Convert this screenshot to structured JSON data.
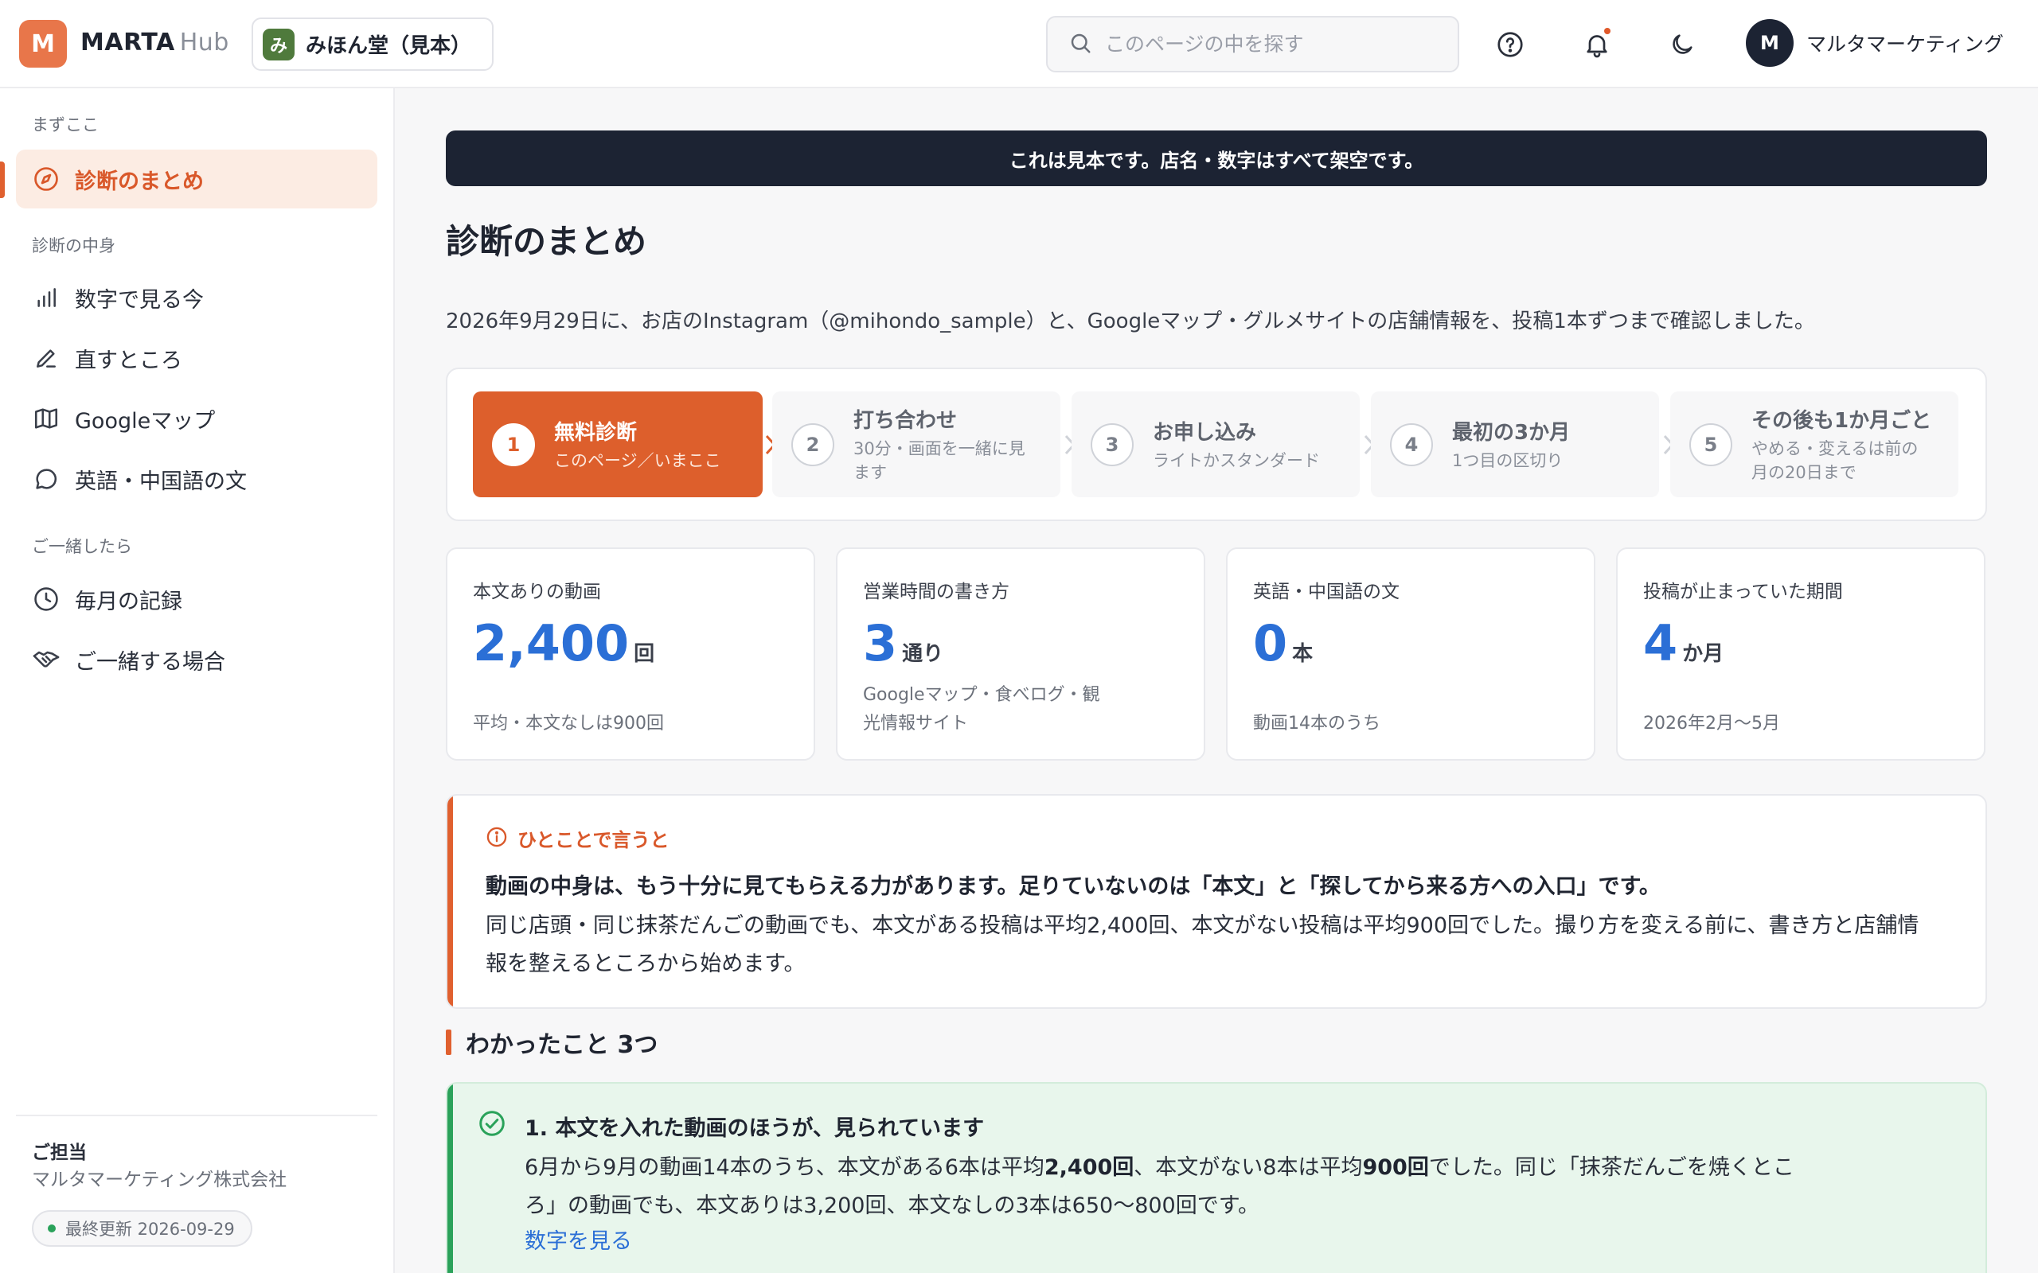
{
  "header": {
    "logo_letter": "M",
    "brand": "MARTA",
    "brand_suffix": "Hub",
    "store_avatar": "み",
    "store_name": "みほん堂（見本）",
    "search_placeholder": "このページの中を探す",
    "user_initial": "M",
    "user_name": "マルタマーケティング",
    "icons": [
      "search-icon",
      "help-icon",
      "bell-icon",
      "moon-icon"
    ],
    "notification_dot_color": "#e0592a"
  },
  "sidebar": {
    "section_start": "まずここ",
    "section_content": "診断の中身",
    "section_together": "ご一緒したら",
    "items": [
      {
        "label": "診断のまとめ",
        "icon": "compass-icon",
        "active": true
      },
      {
        "label": "数字で見る今",
        "icon": "bar-chart-icon"
      },
      {
        "label": "直すところ",
        "icon": "pencil-icon"
      },
      {
        "label": "Googleマップ",
        "icon": "map-icon"
      },
      {
        "label": "英語・中国語の文",
        "icon": "chat-icon"
      },
      {
        "label": "毎月の記録",
        "icon": "clock-icon"
      },
      {
        "label": "ご一緒する場合",
        "icon": "handshake-icon"
      }
    ],
    "owner_label": "ご担当",
    "owner_name": "マルタマーケティング株式会社",
    "updated": "最終更新 2026-09-29"
  },
  "main": {
    "notice": "これは見本です。店名・数字はすべて架空です。",
    "title": "診断のまとめ",
    "intro": "2026年9月29日に、お店のInstagram（@mihondo_sample）と、Googleマップ・グルメサイトの店舗情報を、投稿1本ずつまで確認しました。",
    "steps": [
      {
        "num": "1",
        "title": "無料診断",
        "sub": "このページ／いまここ",
        "active": true
      },
      {
        "num": "2",
        "title": "打ち合わせ",
        "sub": "30分・画面を一緒に見ます"
      },
      {
        "num": "3",
        "title": "お申し込み",
        "sub": "ライトかスタンダード"
      },
      {
        "num": "4",
        "title": "最初の3か月",
        "sub": "1つ目の区切り"
      },
      {
        "num": "5",
        "title": "その後も1か月ごと",
        "sub": "やめる・変えるは前の月の20日まで"
      }
    ],
    "stats": [
      {
        "label": "本文ありの動画",
        "value": "2,400",
        "unit": "回",
        "sub": "平均・本文なしは900回"
      },
      {
        "label": "営業時間の書き方",
        "value": "3",
        "unit": "通り",
        "sub": "Googleマップ・食べログ・観光情報サイト"
      },
      {
        "label": "英語・中国語の文",
        "value": "0",
        "unit": "本",
        "sub": "動画14本のうち"
      },
      {
        "label": "投稿が止まっていた期間",
        "value": "4",
        "unit": "か月",
        "sub": "2026年2月〜5月"
      }
    ],
    "summary": {
      "heading": "ひとことで言うと",
      "lead": "動画の中身は、もう十分に見てもらえる力があります。足りていないのは「本文」と「探してから来る方への入口」です。",
      "body": "同じ店頭・同じ抹茶だんごの動画でも、本文がある投稿は平均2,400回、本文がない投稿は平均900回でした。撮り方を変える前に、書き方と店舗情報を整えるところから始めます。"
    },
    "found_title": "わかったこと 3つ",
    "finding1": {
      "title": "1. 本文を入れた動画のほうが、見られています",
      "body_a": "6月から9月の動画14本のうち、本文がある6本は平均",
      "body_b": "2,400回",
      "body_c": "、本文がない8本は平均",
      "body_d": "900回",
      "body_e": "でした。同じ「抹茶だんごを焼くところ」の動画でも、本文ありは3,200回、本文なしの3本は650〜800回です。",
      "link": "数字を見る"
    }
  },
  "colors": {
    "accent": "#dd5f2c",
    "value_blue": "#2b6fd6",
    "success": "#2aa25a",
    "dark": "#1c2333"
  }
}
